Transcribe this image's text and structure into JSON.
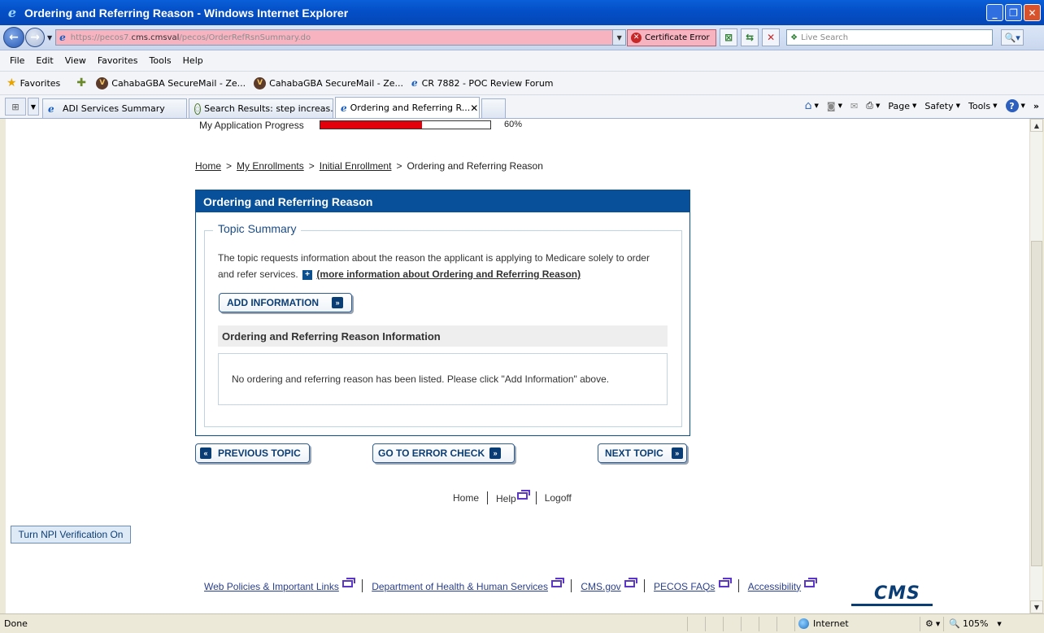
{
  "window": {
    "title": "Ordering and Referring Reason - Windows Internet Explorer"
  },
  "address": {
    "url_prefix": "https://pecos7.",
    "url_domain": "cms.cmsval",
    "url_path": "/pecos/OrderRefRsnSummary.do",
    "cert_error": "Certificate Error",
    "search_placeholder": "Live Search"
  },
  "menu": [
    "File",
    "Edit",
    "View",
    "Favorites",
    "Tools",
    "Help"
  ],
  "favorites": {
    "label": "Favorites",
    "items": [
      "CahabaGBA SecureMail - Ze...",
      "CahabaGBA SecureMail - Ze...",
      "CR 7882 - POC Review Forum"
    ]
  },
  "tabs": [
    {
      "label": "ADI Services Summary"
    },
    {
      "label": "Search Results: step increas..."
    },
    {
      "label": "Ordering and Referring R..."
    }
  ],
  "command_bar": {
    "page": "Page",
    "safety": "Safety",
    "tools": "Tools"
  },
  "page": {
    "progress_label": "My Application Progress",
    "progress_text": "60%",
    "progress_fraction": 0.6,
    "breadcrumb": {
      "home": "Home",
      "enrollments": "My Enrollments",
      "initial": "Initial Enrollment",
      "current": "Ordering and Referring Reason",
      "sep": ">"
    },
    "panel_title": "Ordering and Referring Reason",
    "topic_legend": "Topic Summary",
    "topic_text": "The topic requests information about the reason the applicant is applying to Medicare solely to order and refer services.",
    "more_info": "(more information about Ordering and Referring Reason)",
    "add_info_button": "ADD INFORMATION",
    "info_header": "Ordering and Referring Reason Information",
    "info_empty": "No ordering and referring reason has been listed. Please click \"Add Information\" above.",
    "prev_button": "PREVIOUS TOPIC",
    "error_button": "GO TO ERROR CHECK",
    "next_button": "NEXT TOPIC",
    "footer": {
      "home": "Home",
      "help": "Help",
      "logoff": "Logoff"
    },
    "npi_button": "Turn NPI Verification On",
    "bottom_links": [
      "Web Policies & Important Links",
      "Department of Health & Human Services",
      "CMS.gov",
      "PECOS FAQs",
      "Accessibility"
    ],
    "logo_text": "CMS"
  },
  "status": {
    "text": "Done",
    "zone": "Internet",
    "zoom": "105%"
  }
}
